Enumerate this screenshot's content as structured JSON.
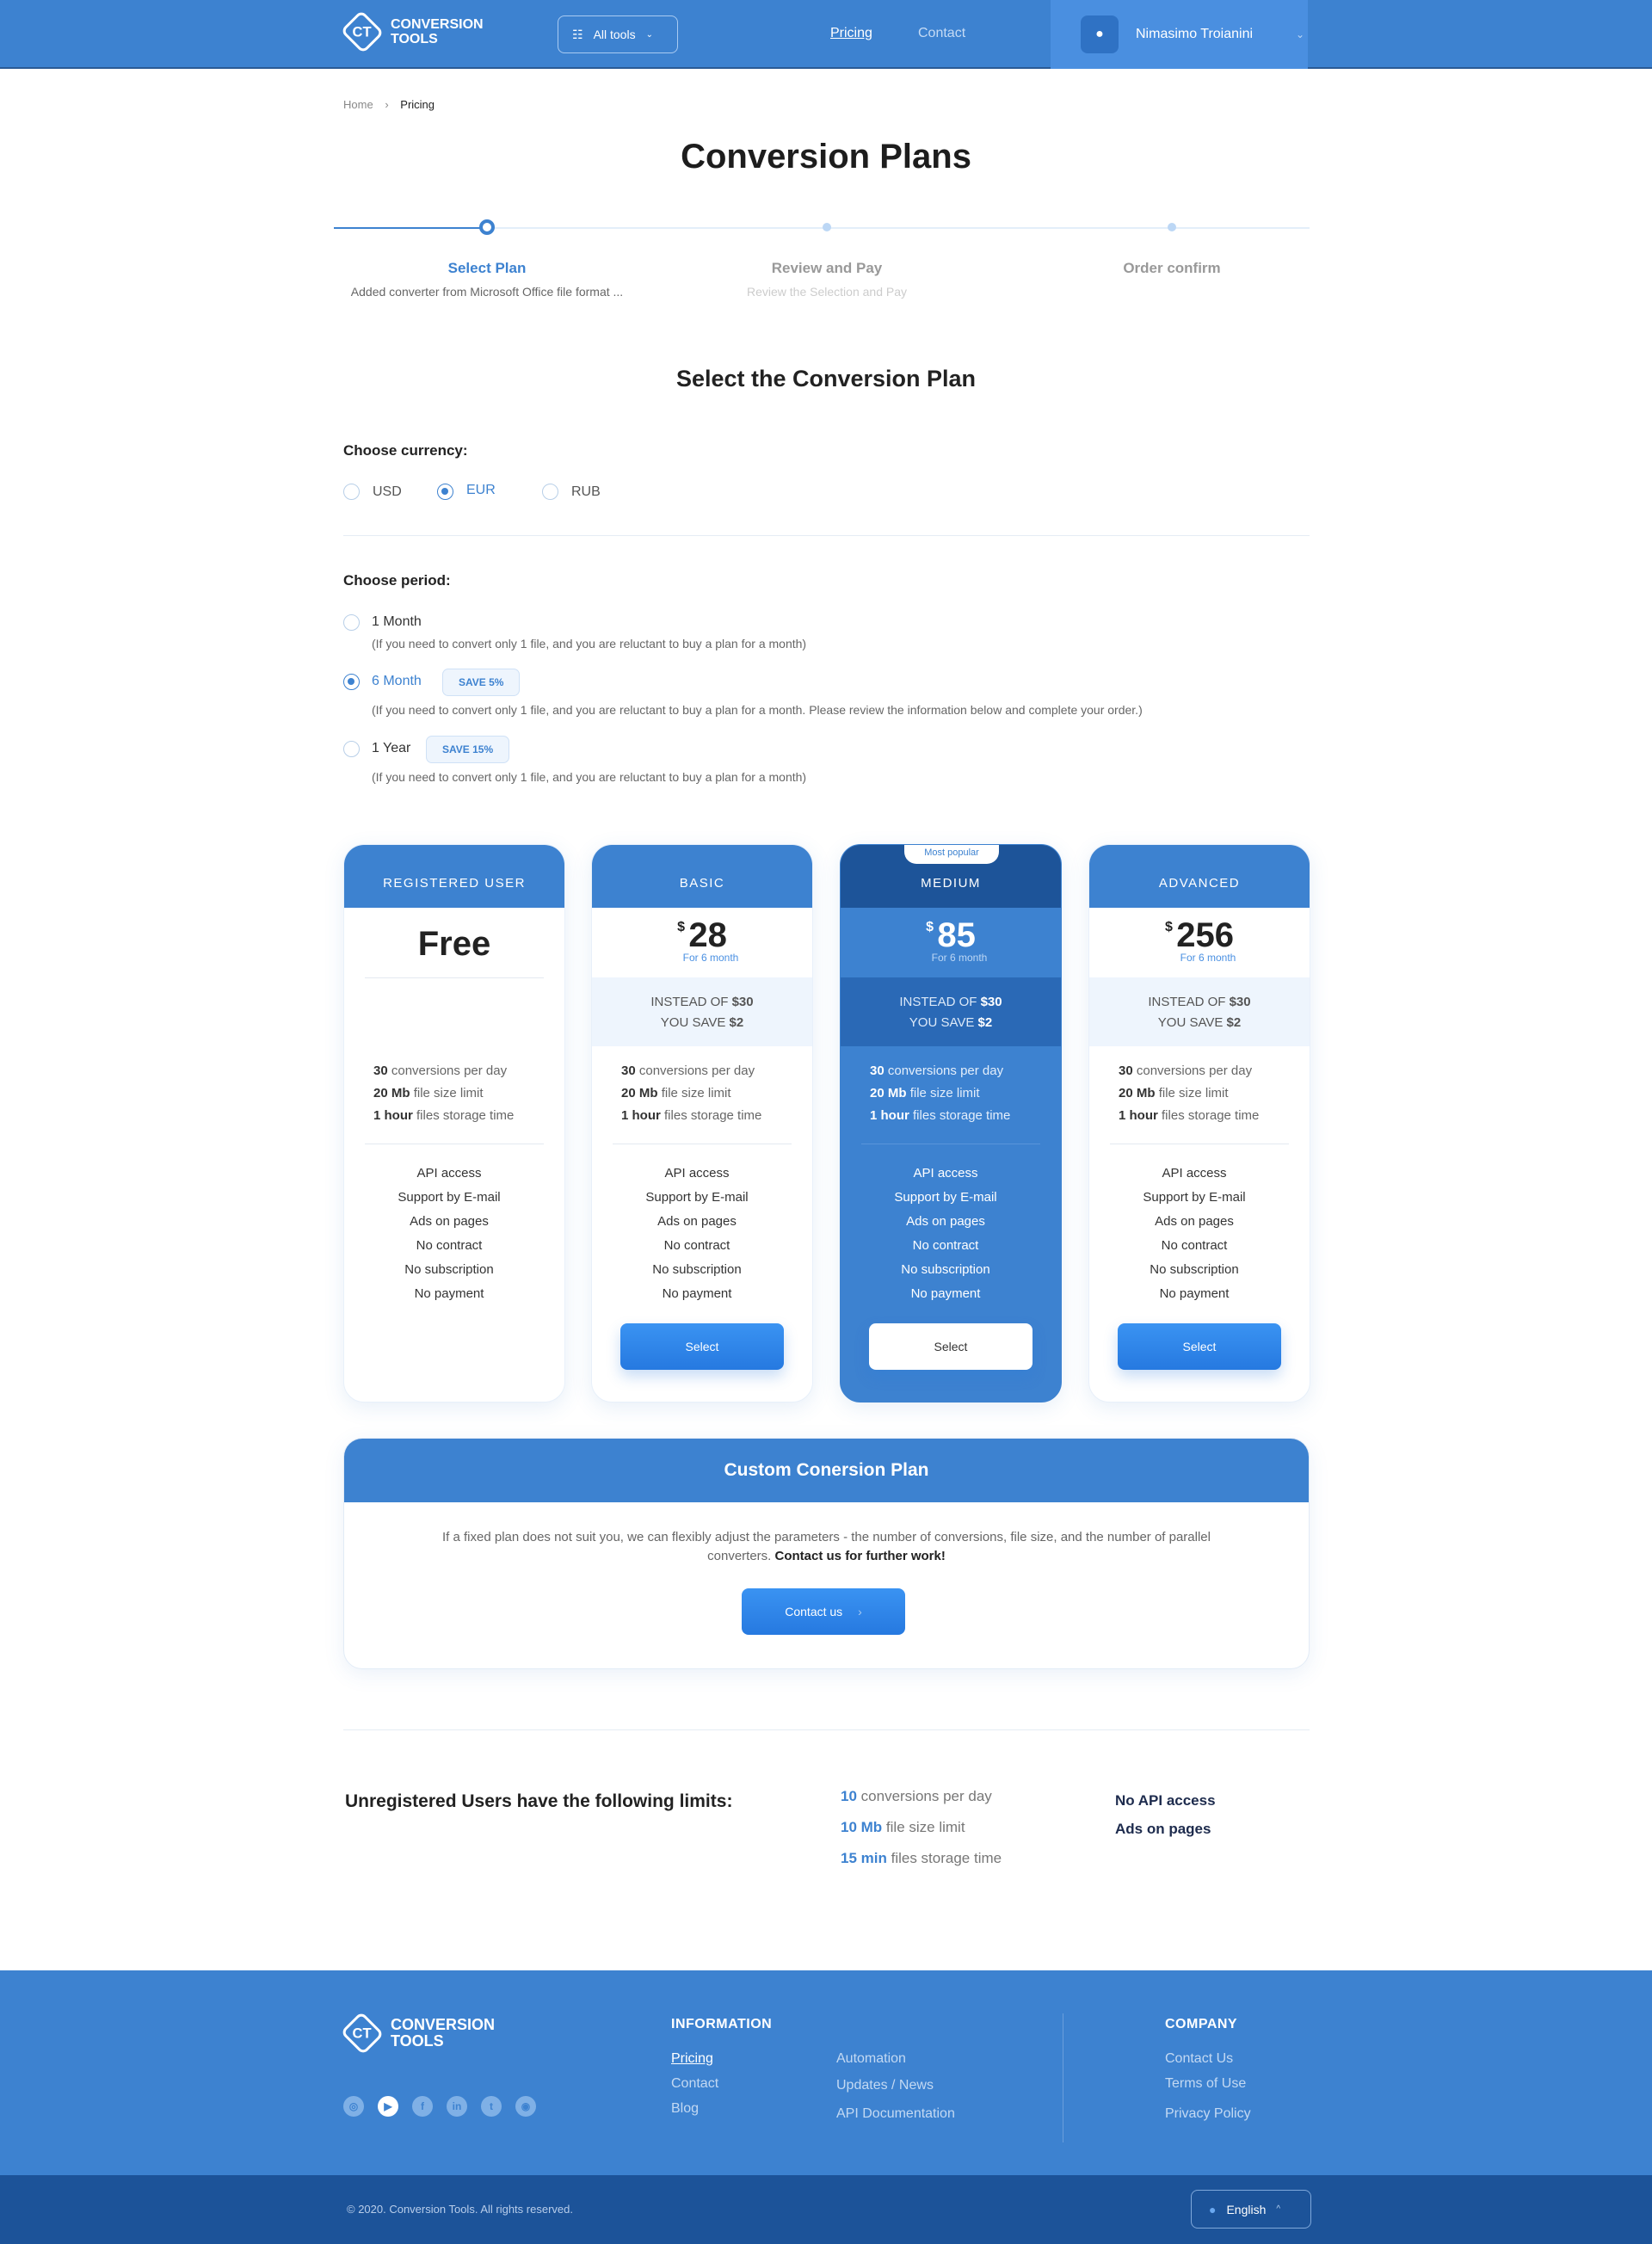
{
  "header": {
    "logo_line1": "CONVERSION",
    "logo_line2": "TOOLS",
    "logo_mark": "CT",
    "all_tools": "All tools",
    "nav": [
      "Pricing",
      "Contact"
    ],
    "user_name": "Nimasimo Troianini"
  },
  "breadcrumb": {
    "home": "Home",
    "current": "Pricing"
  },
  "title": "Conversion Plans",
  "steps": [
    {
      "label": "Select Plan",
      "sub": "Added converter from Microsoft Office file format ..."
    },
    {
      "label": "Review and Pay",
      "sub": "Review the Selection and Pay"
    },
    {
      "label": "Order confirm",
      "sub": ""
    }
  ],
  "section_title": "Select the Conversion Plan",
  "currency": {
    "label": "Choose currency:",
    "options": [
      "USD",
      "EUR",
      "RUB"
    ],
    "selected": "EUR"
  },
  "period": {
    "label": "Choose period:",
    "selected": "6 Month",
    "options": [
      {
        "label": "1 Month",
        "badge": "",
        "desc": "(If you need to convert only 1 file, and you are reluctant to buy a plan for a month)"
      },
      {
        "label": "6 Month",
        "badge": "SAVE 5%",
        "desc": "(If you need to convert only 1 file, and you are reluctant to buy a plan for a month. Please review the information below and complete your order.)"
      },
      {
        "label": "1 Year",
        "badge": "SAVE 15%",
        "desc": "(If you need to convert only 1 file, and you are reluctant to buy a plan for a month)"
      }
    ]
  },
  "plans": {
    "most_popular": "Most popular",
    "currency_symbol": "$",
    "period_text": "For 6 month",
    "instead_label": "INSTEAD OF",
    "instead_value": "$30",
    "save_label": "YOU SAVE",
    "save_value": "$2",
    "features": {
      "conv_n": "30",
      "conv_t": "conversions per day",
      "size_n": "20 Mb",
      "size_t": "file size limit",
      "store_n": "1 hour",
      "store_t": "files storage time"
    },
    "list": [
      "API access",
      "Support by E-mail",
      "Ads on pages",
      "No contract",
      "No subscription",
      "No payment"
    ],
    "select": "Select",
    "items": [
      {
        "name": "REGISTERED USER",
        "price": "Free"
      },
      {
        "name": "BASIC",
        "price": "28"
      },
      {
        "name": "MEDIUM",
        "price": "85"
      },
      {
        "name": "ADVANCED",
        "price": "256"
      }
    ]
  },
  "custom": {
    "title": "Custom Conersion Plan",
    "text": "If a fixed plan does not suit you, we can flexibly adjust the parameters - the number of conversions, file size, and the number of parallel converters.",
    "bold": "Contact us for further work!",
    "button": "Contact us"
  },
  "unregistered": {
    "title": "Unregistered Users have the following limits:",
    "stats": [
      {
        "n": "10",
        "t": "conversions per day"
      },
      {
        "n": "10 Mb",
        "t": "file size limit"
      },
      {
        "n": "15 min",
        "t": "files storage time"
      }
    ],
    "limits": [
      "No API access",
      "Ads on pages"
    ]
  },
  "footer": {
    "information": "INFORMATION",
    "company": "COMPANY",
    "info_col1": [
      "Pricing",
      "Contact",
      "Blog"
    ],
    "info_col2": [
      "Automation",
      "Updates / News",
      "API Documentation"
    ],
    "company_links": [
      "Contact Us",
      "Terms of Use",
      "Privacy Policy"
    ],
    "social": [
      "instagram",
      "youtube",
      "facebook",
      "linkedin",
      "twitter",
      "github"
    ],
    "copyright": "© 2020. Conversion Tools. All rights reserved.",
    "language": "English"
  },
  "colors": {
    "primary": "#3d82d0",
    "dark": "#1c5399",
    "accent": "#2679e0"
  }
}
